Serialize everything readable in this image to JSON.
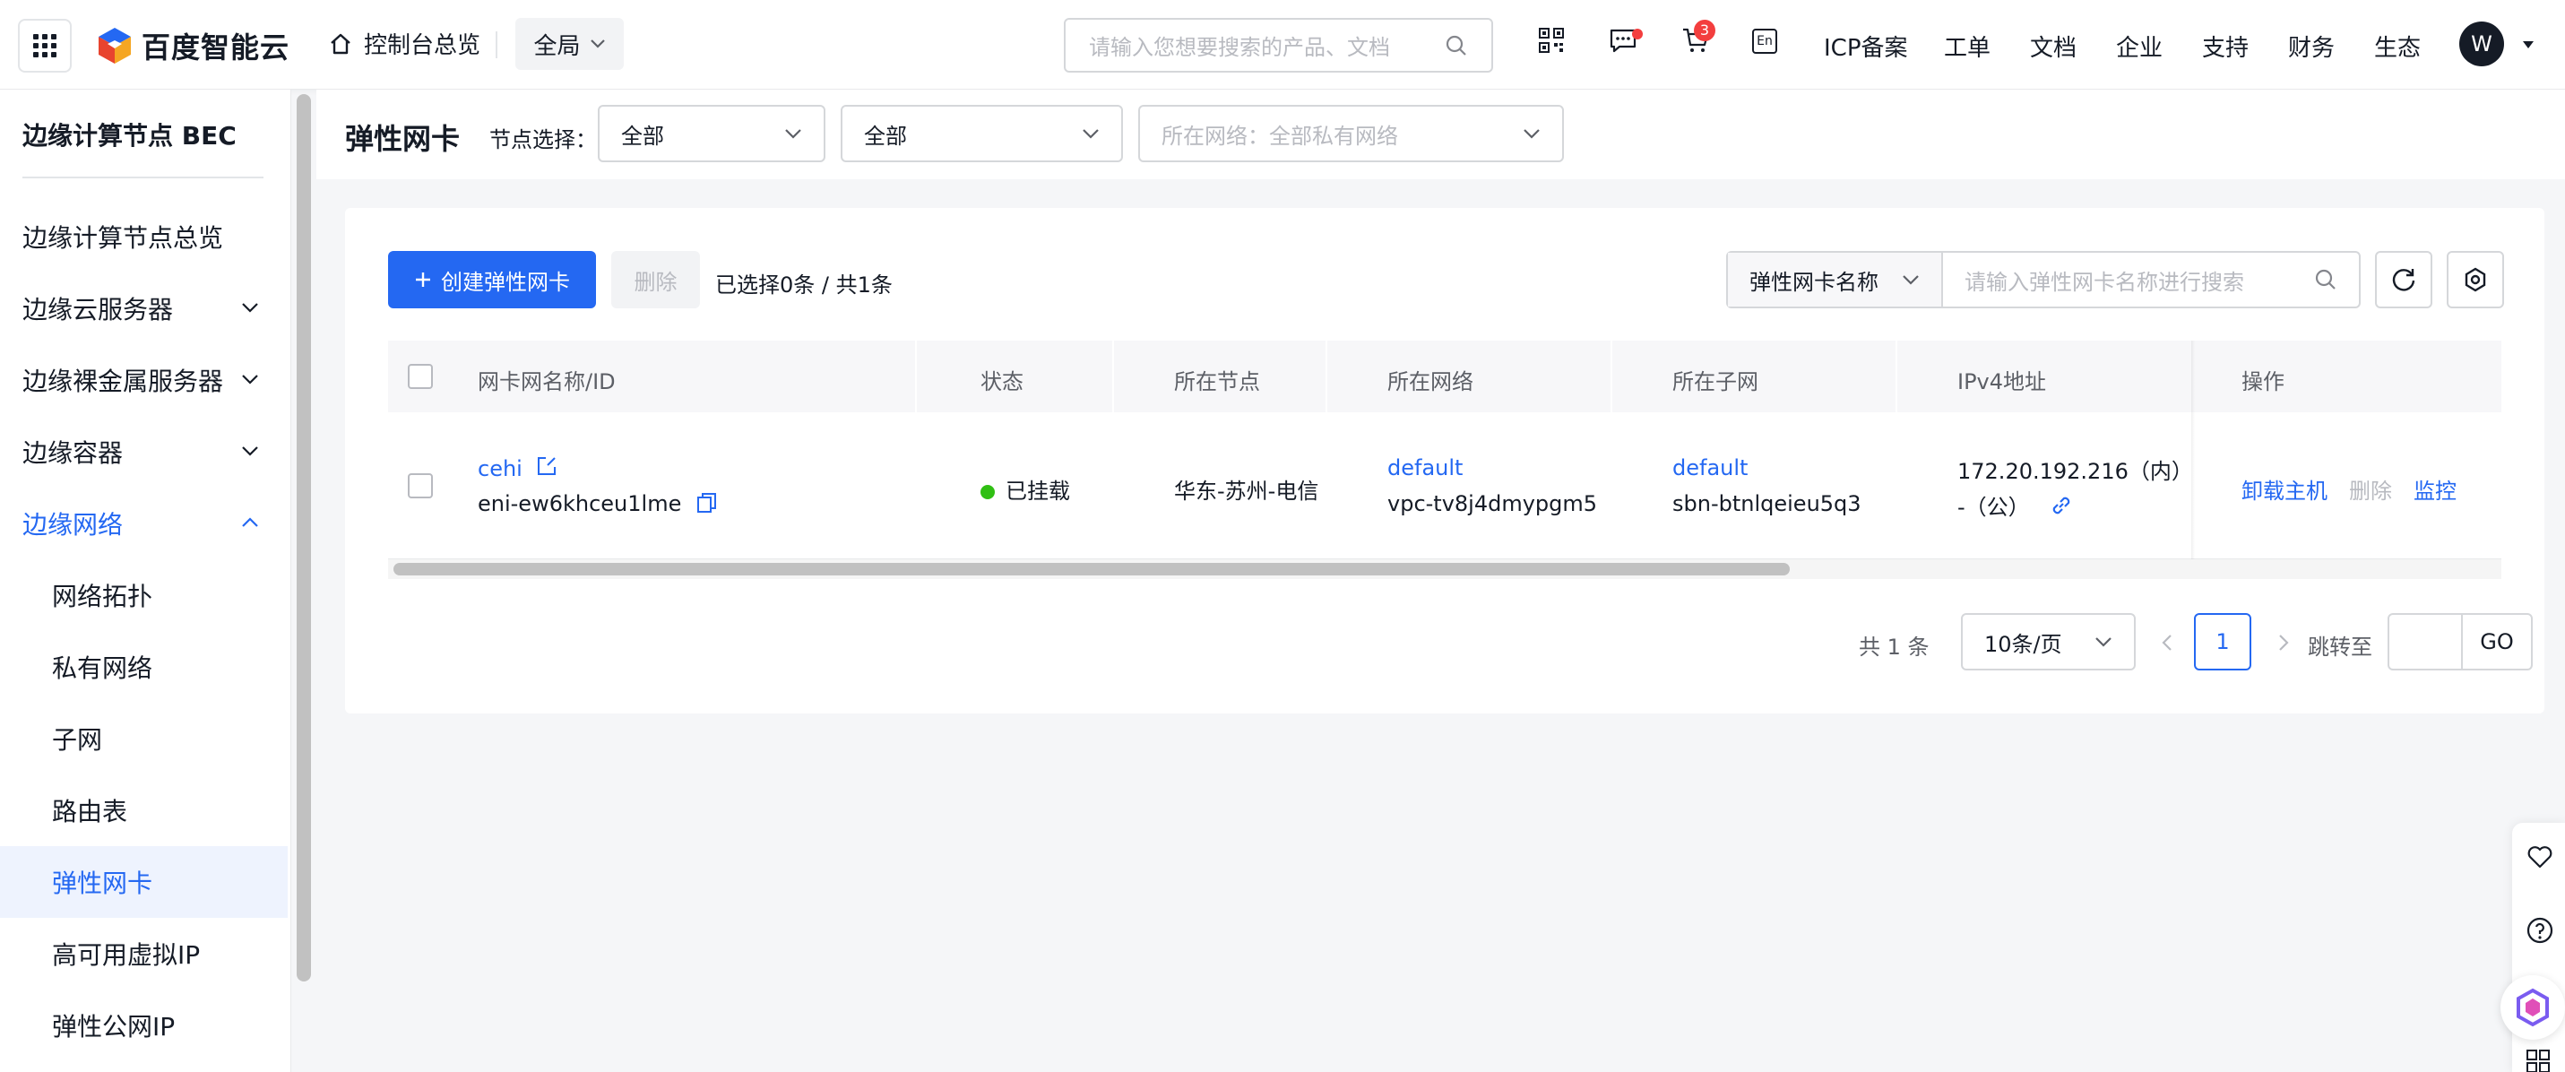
{
  "header": {
    "logo_text": "百度智能云",
    "home_label": "控制台总览",
    "region": "全局",
    "search_placeholder": "请输入您想要搜索的产品、文档",
    "cart_count": "3",
    "lang_label": "En",
    "nav": [
      "ICP备案",
      "工单",
      "文档",
      "企业",
      "支持",
      "财务",
      "生态"
    ],
    "avatar_letter": "W"
  },
  "sidebar": {
    "title": "边缘计算节点 BEC",
    "items": [
      {
        "label": "边缘计算节点总览"
      },
      {
        "label": "边缘云服务器"
      },
      {
        "label": "边缘裸金属服务器"
      },
      {
        "label": "边缘容器"
      },
      {
        "label": "边缘网络"
      },
      {
        "label": "网络拓扑"
      },
      {
        "label": "私有网络"
      },
      {
        "label": "子网"
      },
      {
        "label": "路由表"
      },
      {
        "label": "弹性网卡"
      },
      {
        "label": "高可用虚拟IP"
      },
      {
        "label": "弹性公网IP"
      }
    ]
  },
  "filter": {
    "title": "弹性网卡",
    "node_label": "节点选择：",
    "node_select_1": "全部",
    "node_select_2": "全部",
    "network_placeholder": "所在网络：全部私有网络"
  },
  "toolbar": {
    "create_label": "创建弹性网卡",
    "delete_label": "删除",
    "selection_info": "已选择0条 / 共1条",
    "search_type": "弹性网卡名称",
    "search_placeholder": "请输入弹性网卡名称进行搜索"
  },
  "table": {
    "columns": [
      "网卡网名称/ID",
      "状态",
      "所在节点",
      "所在网络",
      "所在子网",
      "IPv4地址",
      "操作"
    ],
    "rows": [
      {
        "name": "cehi",
        "id": "eni-ew6khceu1lme",
        "status": "已挂载",
        "node": "华东-苏州-电信",
        "network_name": "default",
        "network_id": "vpc-tv8j4dmypgm5",
        "subnet_name": "default",
        "subnet_id": "sbn-btnlqeieu5q3",
        "ipv4_internal": "172.20.192.216（内）",
        "ipv4_public": "-（公）",
        "actions": [
          "卸载主机",
          "删除",
          "监控"
        ]
      }
    ]
  },
  "pagination": {
    "total": "共 1 条",
    "page_size": "10条/页",
    "current_page": "1",
    "jump_label": "跳转至",
    "go_label": "GO"
  },
  "colors": {
    "primary": "#2468f2",
    "success": "#30bf13",
    "danger": "#f33e3e"
  }
}
